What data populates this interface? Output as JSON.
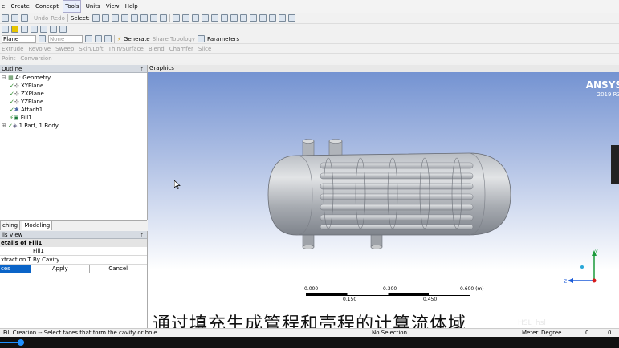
{
  "menu": [
    "e",
    "Create",
    "Concept",
    "Tools",
    "Units",
    "View",
    "Help"
  ],
  "menu_active_index": 3,
  "toolbar1": {
    "undo": "Undo",
    "redo": "Redo",
    "select": "Select:"
  },
  "toolbar3": {
    "plane": "Plane",
    "none": "None",
    "generate": "Generate",
    "share": "Share Topology",
    "parameters": "Parameters"
  },
  "toolbar4": [
    "Extrude",
    "Revolve",
    "Sweep",
    "Skin/Loft",
    "Thin/Surface",
    "Blend",
    "Chamfer",
    "Slice"
  ],
  "toolbar5": [
    "Point",
    "Conversion"
  ],
  "outline": {
    "header": "Outline",
    "items": [
      {
        "label": "A: Geometry",
        "icon": "geometry-icon"
      },
      {
        "label": "XYPlane",
        "icon": "plane-icon"
      },
      {
        "label": "ZXPlane",
        "icon": "plane-icon"
      },
      {
        "label": "YZPlane",
        "icon": "plane-icon"
      },
      {
        "label": "Attach1",
        "icon": "attach-icon"
      },
      {
        "label": "Fill1",
        "icon": "fill-icon"
      },
      {
        "label": "1 Part, 1 Body",
        "icon": "body-icon"
      }
    ]
  },
  "tabs": [
    "ching",
    "Modeling"
  ],
  "details": {
    "header": "ils View",
    "title": "etails of Fill1",
    "rows": [
      {
        "k": "",
        "v": "Fill1"
      },
      {
        "k": "xtraction Type",
        "v": "By Cavity"
      }
    ],
    "faces_label": "ces",
    "apply": "Apply",
    "cancel": "Cancel"
  },
  "graphics": {
    "header": "Graphics",
    "brand": "ANSYS",
    "version": "2019 R3",
    "scale_top": [
      "0.000",
      "0.300",
      "0.600 (m)"
    ],
    "scale_bottom": [
      "0.150",
      "0.450"
    ],
    "axis": {
      "y": "Y",
      "z": "Z"
    }
  },
  "subtitle": "通过填充生成管程和壳程的计算流体域",
  "status": {
    "left": "Fill Creation -- Select faces that form the cavity or hole",
    "center": "No Selection",
    "units": "Meter",
    "angle": "Degree",
    "n1": "0",
    "n2": "0"
  },
  "watermark": "HSL_hsl",
  "colors": {
    "accent": "#0a64c8",
    "graphics_top": "#6f8fd0",
    "video_progress": "#1e90ff"
  }
}
